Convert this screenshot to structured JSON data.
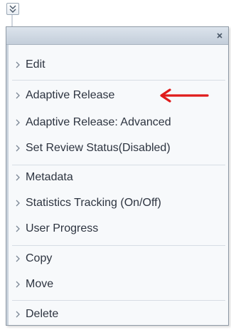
{
  "menu": {
    "close_label": "×",
    "groups": [
      {
        "items": [
          {
            "label": "Edit"
          }
        ]
      },
      {
        "items": [
          {
            "label": "Adaptive Release"
          },
          {
            "label": "Adaptive Release: Advanced"
          },
          {
            "label": "Set Review Status(Disabled)"
          }
        ]
      },
      {
        "items": [
          {
            "label": "Metadata"
          },
          {
            "label": "Statistics Tracking (On/Off)"
          },
          {
            "label": "User Progress"
          }
        ]
      },
      {
        "items": [
          {
            "label": "Copy"
          },
          {
            "label": "Move"
          }
        ]
      },
      {
        "items": [
          {
            "label": "Delete"
          }
        ]
      }
    ]
  },
  "colors": {
    "arrow": "#e01b1b",
    "text": "#2d3440",
    "header": "#c4ceda"
  },
  "icons": {
    "trigger": "double-chevron-down-icon",
    "close": "close-icon",
    "item": "chevron-right-icon",
    "annotation": "red-arrow-left-icon"
  }
}
